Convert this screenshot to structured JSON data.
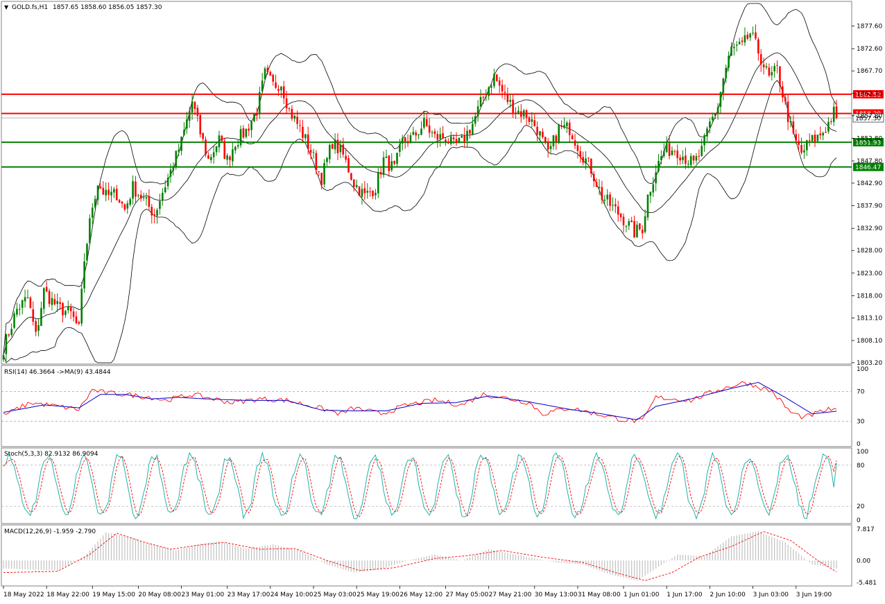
{
  "header": {
    "symbol": "GOLD.fs,H1",
    "ohlc": "1857.65 1858.60 1856.05 1857.30"
  },
  "colors": {
    "bull": "#008000",
    "bear": "#ff0000",
    "resistance": "#ff0000",
    "support": "#008000",
    "rsi": "#ff0000",
    "rsi_ma": "#0000cc",
    "stoch_main": "#20b2aa",
    "stoch_signal": "#ff0000",
    "macd_hist": "#c0c0c0",
    "macd_signal": "#ff0000",
    "band": "#000000"
  },
  "chart_data": [
    {
      "type": "candlestick",
      "name": "price",
      "ylim": [
        1803.2,
        1882.6
      ],
      "y_ticks": [
        "1877.60",
        "1872.60",
        "1867.70",
        "1862.70",
        "1857.80",
        "1852.80",
        "1847.80",
        "1842.90",
        "1837.90",
        "1832.90",
        "1828.00",
        "1823.00",
        "1818.00",
        "1813.10",
        "1808.10",
        "1803.20"
      ],
      "tick_values": [
        1877.6,
        1872.6,
        1867.7,
        1862.7,
        1857.8,
        1852.8,
        1847.8,
        1842.9,
        1837.9,
        1832.9,
        1828.0,
        1823.0,
        1818.0,
        1813.1,
        1808.1,
        1803.2
      ],
      "x_ticks": [
        "18 May 2022",
        "18 May 22:00",
        "19 May 15:00",
        "20 May 08:00",
        "23 May 01:00",
        "23 May 17:00",
        "24 May 10:00",
        "25 May 03:00",
        "25 May 19:00",
        "26 May 12:00",
        "27 May 05:00",
        "27 May 21:00",
        "30 May 13:00",
        "31 May 08:00",
        "1 Jun 01:00",
        "1 Jun 17:00",
        "2 Jun 10:00",
        "3 Jun 03:00",
        "3 Jun 19:00"
      ],
      "levels": [
        {
          "label": "1862.53",
          "value": 1862.53,
          "kind": "resistance"
        },
        {
          "label": "1858.29",
          "value": 1858.29,
          "kind": "resistance"
        },
        {
          "label": "1851.93",
          "value": 1851.93,
          "kind": "support"
        },
        {
          "label": "1846.47",
          "value": 1846.47,
          "kind": "support"
        }
      ],
      "current_price": {
        "label": "1857.30",
        "value": 1857.3
      },
      "anchors": [
        {
          "i": 0,
          "close": 1806.5
        },
        {
          "i": 5,
          "close": 1815
        },
        {
          "i": 9,
          "close": 1817.5
        },
        {
          "i": 12,
          "close": 1809
        },
        {
          "i": 15,
          "close": 1819
        },
        {
          "i": 20,
          "close": 1815.5
        },
        {
          "i": 25,
          "close": 1814
        },
        {
          "i": 28,
          "close": 1810.5
        },
        {
          "i": 30,
          "close": 1826
        },
        {
          "i": 33,
          "close": 1838
        },
        {
          "i": 35,
          "close": 1843
        },
        {
          "i": 38,
          "close": 1840
        },
        {
          "i": 42,
          "close": 1840.5
        },
        {
          "i": 45,
          "close": 1837
        },
        {
          "i": 48,
          "close": 1842
        },
        {
          "i": 51,
          "close": 1840
        },
        {
          "i": 56,
          "close": 1836
        },
        {
          "i": 59,
          "close": 1841
        },
        {
          "i": 62,
          "close": 1845.5
        },
        {
          "i": 66,
          "close": 1852
        },
        {
          "i": 70,
          "close": 1861
        },
        {
          "i": 73,
          "close": 1854
        },
        {
          "i": 76,
          "close": 1848
        },
        {
          "i": 80,
          "close": 1852.5
        },
        {
          "i": 83,
          "close": 1848
        },
        {
          "i": 86,
          "close": 1852
        },
        {
          "i": 90,
          "close": 1854.5
        },
        {
          "i": 94,
          "close": 1859
        },
        {
          "i": 97,
          "close": 1867
        },
        {
          "i": 100,
          "close": 1864.5
        },
        {
          "i": 103,
          "close": 1865
        },
        {
          "i": 106,
          "close": 1859
        },
        {
          "i": 110,
          "close": 1855
        },
        {
          "i": 114,
          "close": 1850
        },
        {
          "i": 118,
          "close": 1844
        },
        {
          "i": 122,
          "close": 1852
        },
        {
          "i": 126,
          "close": 1849
        },
        {
          "i": 130,
          "close": 1843
        },
        {
          "i": 134,
          "close": 1840
        },
        {
          "i": 138,
          "close": 1842
        },
        {
          "i": 141,
          "close": 1848
        },
        {
          "i": 145,
          "close": 1846
        },
        {
          "i": 148,
          "close": 1852
        },
        {
          "i": 152,
          "close": 1853
        },
        {
          "i": 156,
          "close": 1856
        },
        {
          "i": 160,
          "close": 1853
        },
        {
          "i": 164,
          "close": 1853
        },
        {
          "i": 167,
          "close": 1851
        },
        {
          "i": 170,
          "close": 1852
        },
        {
          "i": 174,
          "close": 1856
        },
        {
          "i": 178,
          "close": 1862
        },
        {
          "i": 182,
          "close": 1866.5
        },
        {
          "i": 186,
          "close": 1862
        },
        {
          "i": 190,
          "close": 1859
        },
        {
          "i": 194,
          "close": 1858
        },
        {
          "i": 198,
          "close": 1855
        },
        {
          "i": 202,
          "close": 1849
        },
        {
          "i": 206,
          "close": 1855
        },
        {
          "i": 210,
          "close": 1855
        },
        {
          "i": 214,
          "close": 1850
        },
        {
          "i": 218,
          "close": 1846
        },
        {
          "i": 222,
          "close": 1840
        },
        {
          "i": 226,
          "close": 1837.5
        },
        {
          "i": 230,
          "close": 1835
        },
        {
          "i": 234,
          "close": 1832
        },
        {
          "i": 237,
          "close": 1833
        },
        {
          "i": 239,
          "close": 1840
        },
        {
          "i": 242,
          "close": 1846
        },
        {
          "i": 245,
          "close": 1850
        },
        {
          "i": 249,
          "close": 1850.5
        },
        {
          "i": 253,
          "close": 1848.5
        },
        {
          "i": 256,
          "close": 1847
        },
        {
          "i": 259,
          "close": 1850
        },
        {
          "i": 262,
          "close": 1856
        },
        {
          "i": 265,
          "close": 1860
        },
        {
          "i": 267,
          "close": 1866
        },
        {
          "i": 270,
          "close": 1872.5
        },
        {
          "i": 274,
          "close": 1873
        },
        {
          "i": 277,
          "close": 1876
        },
        {
          "i": 280,
          "close": 1872
        },
        {
          "i": 284,
          "close": 1866
        },
        {
          "i": 287,
          "close": 1868
        },
        {
          "i": 290,
          "close": 1860
        },
        {
          "i": 293,
          "close": 1853
        },
        {
          "i": 296,
          "close": 1849.5
        },
        {
          "i": 299,
          "close": 1852
        },
        {
          "i": 302,
          "close": 1853
        },
        {
          "i": 305,
          "close": 1855
        },
        {
          "i": 308,
          "close": 1858.5
        },
        {
          "i": 309,
          "close": 1857.3
        }
      ]
    },
    {
      "type": "line",
      "name": "rsi",
      "label": "RSI(14) 46.3664 ->MA(9) 43.4844",
      "ylim": [
        0,
        100
      ],
      "y_ticks": [
        "100",
        "70",
        "30",
        "0"
      ],
      "tick_values": [
        100,
        70,
        30,
        0
      ],
      "levels": [
        70,
        30
      ],
      "rsi_anchors": [
        [
          0,
          38
        ],
        [
          10,
          55
        ],
        [
          20,
          50
        ],
        [
          28,
          46
        ],
        [
          33,
          72
        ],
        [
          38,
          68
        ],
        [
          45,
          66
        ],
        [
          55,
          62
        ],
        [
          60,
          58
        ],
        [
          70,
          66
        ],
        [
          75,
          62
        ],
        [
          85,
          55
        ],
        [
          95,
          60
        ],
        [
          105,
          58
        ],
        [
          115,
          50
        ],
        [
          125,
          40
        ],
        [
          130,
          48
        ],
        [
          140,
          40
        ],
        [
          150,
          52
        ],
        [
          160,
          58
        ],
        [
          170,
          52
        ],
        [
          178,
          66
        ],
        [
          185,
          62
        ],
        [
          195,
          55
        ],
        [
          200,
          40
        ],
        [
          210,
          48
        ],
        [
          220,
          40
        ],
        [
          230,
          32
        ],
        [
          237,
          30
        ],
        [
          242,
          62
        ],
        [
          255,
          58
        ],
        [
          265,
          72
        ],
        [
          275,
          82
        ],
        [
          285,
          70
        ],
        [
          292,
          42
        ],
        [
          297,
          35
        ],
        [
          305,
          45
        ],
        [
          309,
          46.4
        ]
      ],
      "ma_anchors": [
        [
          0,
          42
        ],
        [
          15,
          52
        ],
        [
          28,
          48
        ],
        [
          36,
          66
        ],
        [
          45,
          66
        ],
        [
          55,
          60
        ],
        [
          65,
          62
        ],
        [
          75,
          60
        ],
        [
          90,
          58
        ],
        [
          105,
          58
        ],
        [
          118,
          45
        ],
        [
          130,
          44
        ],
        [
          142,
          44
        ],
        [
          155,
          54
        ],
        [
          168,
          55
        ],
        [
          180,
          64
        ],
        [
          195,
          56
        ],
        [
          210,
          46
        ],
        [
          222,
          40
        ],
        [
          235,
          32
        ],
        [
          242,
          50
        ],
        [
          255,
          60
        ],
        [
          270,
          74
        ],
        [
          280,
          82
        ],
        [
          290,
          62
        ],
        [
          300,
          40
        ],
        [
          309,
          43.5
        ]
      ]
    },
    {
      "type": "line",
      "name": "stochastic",
      "label": "Stoch(5,3,3) 82.9132 86.9094",
      "ylim": [
        0,
        100
      ],
      "y_ticks": [
        "100",
        "80",
        "20",
        "0"
      ],
      "tick_values": [
        100,
        80,
        20,
        0
      ],
      "levels": [
        80,
        20
      ],
      "final_main": 82.9132,
      "final_signal": 86.9094
    },
    {
      "type": "bar",
      "name": "macd",
      "label": "MACD(12,26,9) -1.959 -2.790",
      "ylim": [
        -5.481,
        7.817
      ],
      "y_ticks": [
        "7.817",
        "0.00",
        "-5.481"
      ],
      "tick_values": [
        7.817,
        0,
        -5.481
      ],
      "hist_anchors": [
        [
          0,
          -2
        ],
        [
          20,
          -2.5
        ],
        [
          30,
          1
        ],
        [
          38,
          7
        ],
        [
          46,
          6
        ],
        [
          55,
          4
        ],
        [
          64,
          2.5
        ],
        [
          72,
          4
        ],
        [
          80,
          4.8
        ],
        [
          90,
          3
        ],
        [
          100,
          4
        ],
        [
          110,
          2.5
        ],
        [
          120,
          -1
        ],
        [
          130,
          -3
        ],
        [
          140,
          -2.2
        ],
        [
          150,
          0
        ],
        [
          160,
          1.5
        ],
        [
          170,
          0
        ],
        [
          180,
          2.8
        ],
        [
          190,
          1.5
        ],
        [
          205,
          -0.5
        ],
        [
          215,
          -1
        ],
        [
          225,
          -3.5
        ],
        [
          235,
          -5
        ],
        [
          242,
          -2
        ],
        [
          250,
          1.5
        ],
        [
          260,
          1
        ],
        [
          270,
          6
        ],
        [
          280,
          7.3
        ],
        [
          290,
          4.5
        ],
        [
          300,
          -1
        ],
        [
          309,
          -2.0
        ]
      ],
      "signal_anchors": [
        [
          0,
          -3
        ],
        [
          20,
          -2.7
        ],
        [
          32,
          1.5
        ],
        [
          42,
          6.8
        ],
        [
          52,
          4.6
        ],
        [
          62,
          2.8
        ],
        [
          72,
          3.8
        ],
        [
          82,
          4.5
        ],
        [
          95,
          2.8
        ],
        [
          108,
          3
        ],
        [
          120,
          0
        ],
        [
          132,
          -2.5
        ],
        [
          145,
          -1.8
        ],
        [
          160,
          0.5
        ],
        [
          172,
          1.2
        ],
        [
          185,
          2.5
        ],
        [
          200,
          0.8
        ],
        [
          215,
          -0.5
        ],
        [
          228,
          -3.2
        ],
        [
          238,
          -5
        ],
        [
          248,
          -3
        ],
        [
          258,
          0.8
        ],
        [
          270,
          3.5
        ],
        [
          282,
          7.2
        ],
        [
          292,
          5
        ],
        [
          302,
          0
        ],
        [
          309,
          -2.79
        ]
      ]
    }
  ]
}
